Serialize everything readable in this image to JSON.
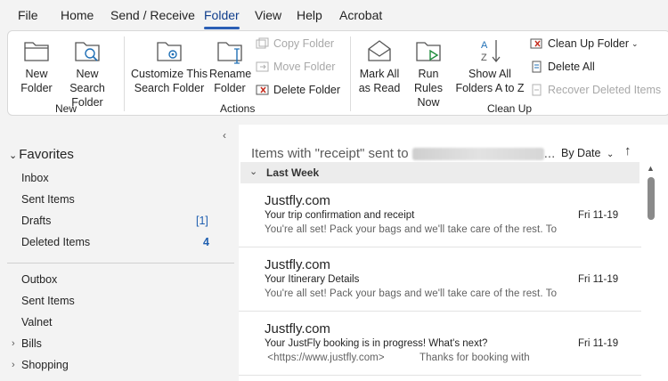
{
  "menu": {
    "items": [
      "File",
      "Home",
      "Send / Receive",
      "Folder",
      "View",
      "Help",
      "Acrobat"
    ],
    "active": "Folder"
  },
  "ribbon": {
    "new_group": {
      "label": "New",
      "new_folder": [
        "New",
        "Folder"
      ],
      "new_search_folder": [
        "New Search",
        "Folder"
      ]
    },
    "actions_group": {
      "label": "Actions",
      "customize_search_folder": [
        "Customize This",
        "Search Folder"
      ],
      "rename_folder": [
        "Rename",
        "Folder"
      ],
      "copy_folder": "Copy Folder",
      "move_folder": "Move Folder",
      "delete_folder": "Delete Folder"
    },
    "cleanup_group": {
      "label": "Clean Up",
      "mark_all_read": [
        "Mark All",
        "as Read"
      ],
      "run_rules_now": [
        "Run Rules",
        "Now"
      ],
      "show_all_folders": [
        "Show All",
        "Folders A to Z"
      ],
      "clean_up_folder": "Clean Up Folder",
      "delete_all": "Delete All",
      "recover_deleted": "Recover Deleted Items"
    }
  },
  "nav": {
    "favorites_label": "Favorites",
    "favorites": [
      {
        "label": "Inbox",
        "count": ""
      },
      {
        "label": "Sent Items",
        "count": ""
      },
      {
        "label": "Drafts",
        "count": "[1]"
      },
      {
        "label": "Deleted Items",
        "count": "4"
      }
    ],
    "folders": [
      {
        "label": "Outbox"
      },
      {
        "label": "Sent Items"
      },
      {
        "label": "Valnet"
      },
      {
        "label": "Bills"
      },
      {
        "label": "Shopping"
      }
    ]
  },
  "list": {
    "header_prefix": "Items with \"receipt\" sent to",
    "header_suffix": "...",
    "sort_label": "By Date",
    "group_label": "Last Week",
    "messages": [
      {
        "from": "Justfly.com",
        "subject": "Your trip confirmation and receipt",
        "date": "Fri 11-19",
        "preview": "You're all set! Pack your bags and we'll take care of the rest. To"
      },
      {
        "from": "Justfly.com",
        "subject": "Your Itinerary Details",
        "date": "Fri 11-19",
        "preview": "You're all set! Pack your bags and we'll take care of the rest. To"
      },
      {
        "from": "Justfly.com",
        "subject": "Your JustFly booking is in progress! What's next?",
        "date": "Fri 11-19",
        "preview": " <https://www.justfly.com>            Thanks for booking with"
      }
    ]
  },
  "colors": {
    "accent": "#2b5fb5",
    "count_blue": "#1f5fb0"
  }
}
